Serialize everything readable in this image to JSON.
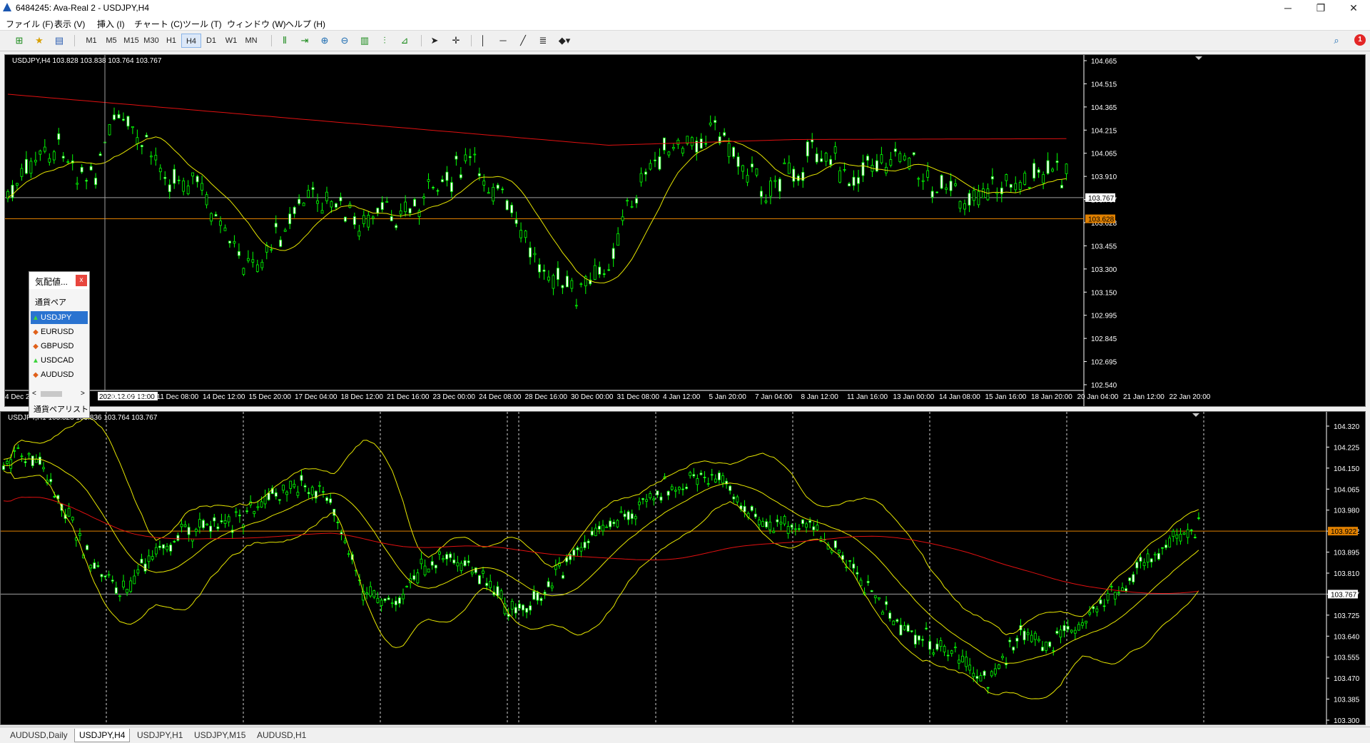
{
  "window": {
    "title": "6484245: Ava-Real 2 - USDJPY,H4",
    "min": "─",
    "max": "❐",
    "close": "✕"
  },
  "menu": [
    "ファイル (F)",
    "表示 (V)",
    "挿入 (I)",
    "チャート (C)",
    "ツール (T)",
    "ウィンドウ (W)",
    "ヘルプ (H)"
  ],
  "toolbar": {
    "timeframes": [
      "M1",
      "M5",
      "M15",
      "M30",
      "H1",
      "H4",
      "D1",
      "W1",
      "MN"
    ],
    "active_timeframe": "H4",
    "notification_count": "1",
    "icons": [
      "new-chart-icon",
      "profiles-icon",
      "market-watch-icon",
      "chart-bar-icon",
      "autoscroll-icon",
      "zoom-in-icon",
      "zoom-out-icon",
      "tile-icon",
      "period-separator-icon",
      "indicator-icon",
      "cursor-icon",
      "crosshair-icon",
      "vertical-line-icon",
      "horizontal-line-icon",
      "trendline-icon",
      "fibo-icon",
      "shapes-icon",
      "search-icon"
    ]
  },
  "chart1": {
    "info": "USDJPY,H4  103.828 103.838 103.764 103.767",
    "price_axis": [
      "104.665",
      "104.515",
      "104.365",
      "104.215",
      "104.065",
      "103.910",
      "103.767",
      "103.628",
      "103.455",
      "103.300",
      "103.150",
      "102.995",
      "102.845",
      "102.695",
      "102.540"
    ],
    "current_price": "103.767",
    "hline_price": "103.628",
    "crosshair_time": "2020.12.09 12:00",
    "time_axis": [
      "4 Dec 20",
      "2020.12.09 12:00",
      "Dec 00:00",
      "11 Dec 08:00",
      "14 Dec 12:00",
      "15 Dec 20:00",
      "17 Dec 04:00",
      "18 Dec 12:00",
      "21 Dec 16:00",
      "23 Dec 00:00",
      "24 Dec 08:00",
      "28 Dec 16:00",
      "30 Dec 00:00",
      "31 Dec 08:00",
      "4 Jan 12:00",
      "5 Jan 20:00",
      "7 Jan 04:00",
      "8 Jan 12:00",
      "11 Jan 16:00",
      "13 Jan 00:00",
      "14 Jan 08:00",
      "15 Jan 16:00",
      "18 Jan 20:00",
      "20 Jan 04:00",
      "21 Jan 12:00",
      "22 Jan 20:00"
    ],
    "candle_color": "#00ff00",
    "ma_fast_color": "#e6e600",
    "ma_slow_color": "#e01010"
  },
  "chart2": {
    "info": "USDJPY,H1  103.828 103.836 103.764 103.767",
    "price_axis": [
      "104.320",
      "104.225",
      "104.150",
      "104.065",
      "103.980",
      "103.922",
      "103.895",
      "103.810",
      "103.767",
      "103.725",
      "103.640",
      "103.555",
      "103.470",
      "103.385",
      "103.300"
    ],
    "current_price": "103.767",
    "hline_price": "103.922",
    "bollinger_color": "#e6e600",
    "ma_color": "#e01010"
  },
  "market_watch": {
    "title": "気配値...",
    "close": "x",
    "column": "通貨ペア",
    "pairs": [
      {
        "symbol": "USDJPY",
        "dir": "up"
      },
      {
        "symbol": "EURUSD",
        "dir": "down"
      },
      {
        "symbol": "GBPUSD",
        "dir": "down"
      },
      {
        "symbol": "USDCAD",
        "dir": "up"
      },
      {
        "symbol": "AUDUSD",
        "dir": "down"
      }
    ],
    "footer": "通貨ペアリスト"
  },
  "tabs": [
    "AUDUSD,Daily",
    "USDJPY,H4",
    "USDJPY,H1",
    "USDJPY,M15",
    "AUDUSD,H1"
  ],
  "active_tab": "USDJPY,H4"
}
